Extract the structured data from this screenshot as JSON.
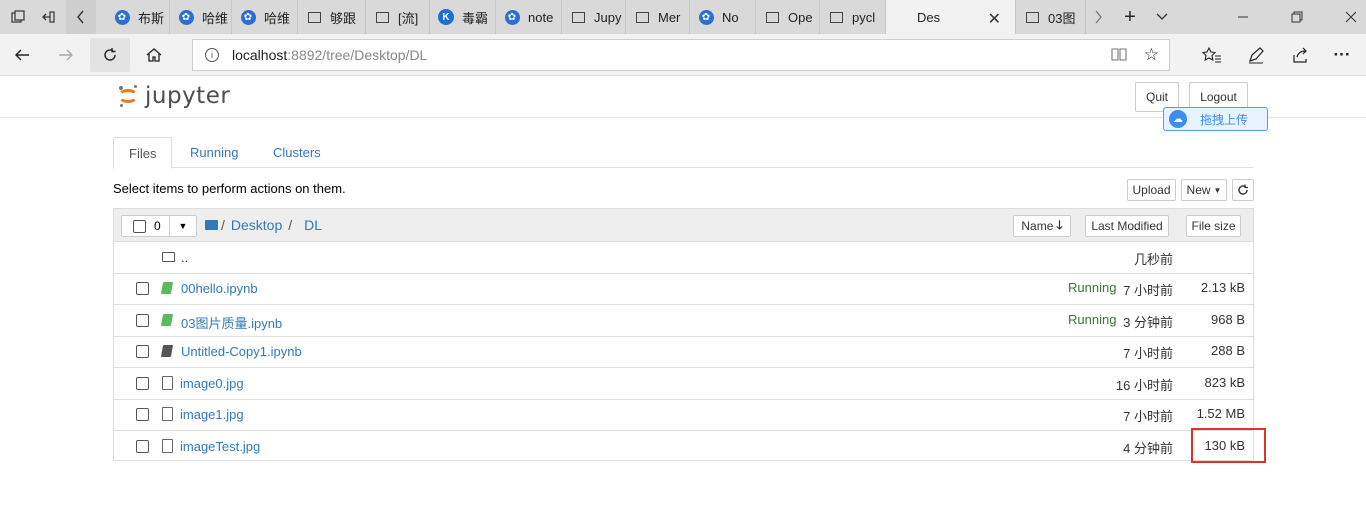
{
  "browser": {
    "tabs": [
      {
        "label": "布斯",
        "icon": "baidu-paw-icon"
      },
      {
        "label": "哈维",
        "icon": "baidu-paw-icon"
      },
      {
        "label": "哈维",
        "icon": "baidu-paw-icon"
      },
      {
        "label": "够跟",
        "icon": "window-icon"
      },
      {
        "label": "[流]",
        "icon": "window-icon"
      },
      {
        "label": "毒霸",
        "icon": "k-icon"
      },
      {
        "label": "note",
        "icon": "baidu-paw-icon"
      },
      {
        "label": "Jupy",
        "icon": "window-icon"
      },
      {
        "label": "Mer",
        "icon": "window-icon"
      },
      {
        "label": "No",
        "icon": "baidu-paw-icon"
      },
      {
        "label": "Ope",
        "icon": "window-icon"
      },
      {
        "label": "pycl",
        "icon": "window-icon"
      },
      {
        "label": "Des",
        "icon": "none",
        "active": true
      },
      {
        "label": "03图",
        "icon": "window-icon"
      }
    ],
    "url_host": "localhost",
    "url_rest": ":8892/tree/Desktop/DL"
  },
  "jupyter": {
    "logo_text": "jupyter",
    "quit_label": "Quit",
    "logout_label": "Logout",
    "baidu_upload_label": "拖拽上传",
    "tabs": [
      "Files",
      "Running",
      "Clusters"
    ],
    "hint": "Select items to perform actions on them.",
    "upload_label": "Upload",
    "new_label": "New",
    "selected_count": "0",
    "breadcrumb": [
      "Desktop",
      "DL"
    ],
    "columns": {
      "name": "Name",
      "modified": "Last Modified",
      "size": "File size"
    },
    "parent": {
      "name": "..",
      "modified": "几秒前"
    },
    "files": [
      {
        "name": "00hello.ipynb",
        "type": "notebook-running",
        "status": "Running",
        "modified": "7 小时前",
        "size": "2.13 kB"
      },
      {
        "name": "03图片质量.ipynb",
        "type": "notebook-running",
        "status": "Running",
        "modified": "3 分钟前",
        "size": "968 B"
      },
      {
        "name": "Untitled-Copy1.ipynb",
        "type": "notebook",
        "status": "",
        "modified": "7 小时前",
        "size": "288 B"
      },
      {
        "name": "image0.jpg",
        "type": "file",
        "status": "",
        "modified": "16 小时前",
        "size": "823 kB"
      },
      {
        "name": "image1.jpg",
        "type": "file",
        "status": "",
        "modified": "7 小时前",
        "size": "1.52 MB"
      },
      {
        "name": "imageTest.jpg",
        "type": "file",
        "status": "",
        "modified": "4 分钟前",
        "size": "130 kB"
      }
    ]
  },
  "colors": {
    "link": "#337ab7",
    "running": "#3c763d",
    "highlight": "#e03030",
    "jupyter_orange": "#f37726"
  }
}
